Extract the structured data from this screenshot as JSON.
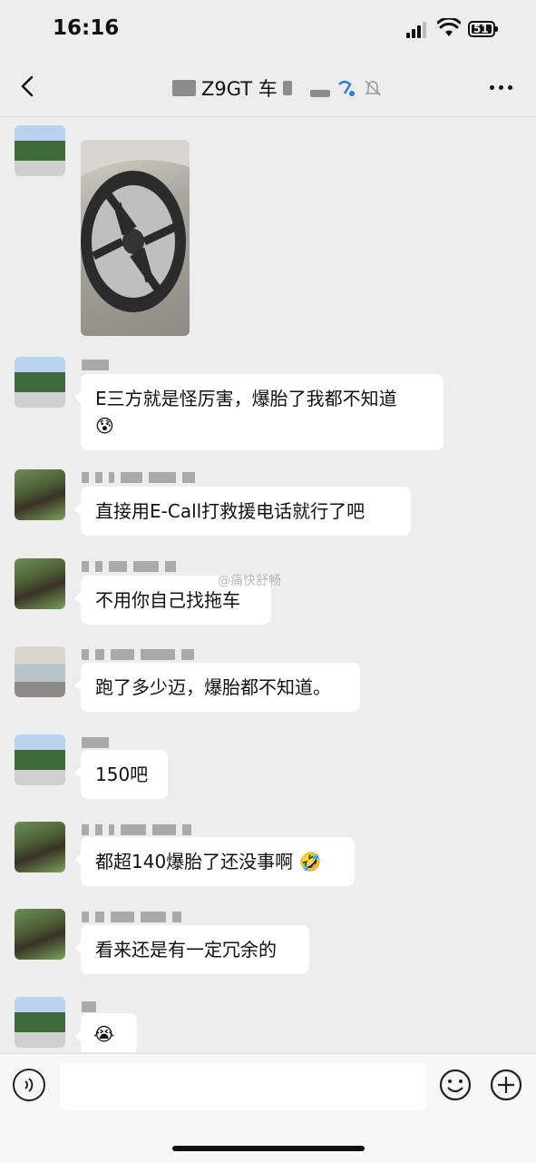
{
  "status_bar": {
    "time": "16:16",
    "battery": "51"
  },
  "header": {
    "title": "Z9GT 车"
  },
  "messages": [
    {
      "type": "image",
      "avatar": "mountain-avatar"
    },
    {
      "type": "text",
      "avatar": "mountain-avatar",
      "text": "E三方就是怪厉害，爆胎了我都不知道"
    },
    {
      "type": "text",
      "avatar": "buffalo-avatar",
      "text": "直接用E-Call打救援电话就行了吧"
    },
    {
      "type": "text",
      "avatar": "buffalo-avatar",
      "text": "不用你自己找拖车"
    },
    {
      "type": "text",
      "avatar": "bowl-avatar",
      "text": "跑了多少迈，爆胎都不知道。"
    },
    {
      "type": "text",
      "avatar": "mountain-avatar",
      "text": "150吧"
    },
    {
      "type": "text",
      "avatar": "buffalo-avatar",
      "text": "都超140爆胎了还没事啊"
    },
    {
      "type": "text",
      "avatar": "buffalo-avatar",
      "text": "看来还是有一定冗余的"
    },
    {
      "type": "emoji",
      "avatar": "mountain-avatar"
    }
  ],
  "watermark": "@痛快舒畅",
  "colors": {
    "background": "#ededed",
    "bubble": "#ffffff",
    "input_bar": "#f7f7f7"
  }
}
